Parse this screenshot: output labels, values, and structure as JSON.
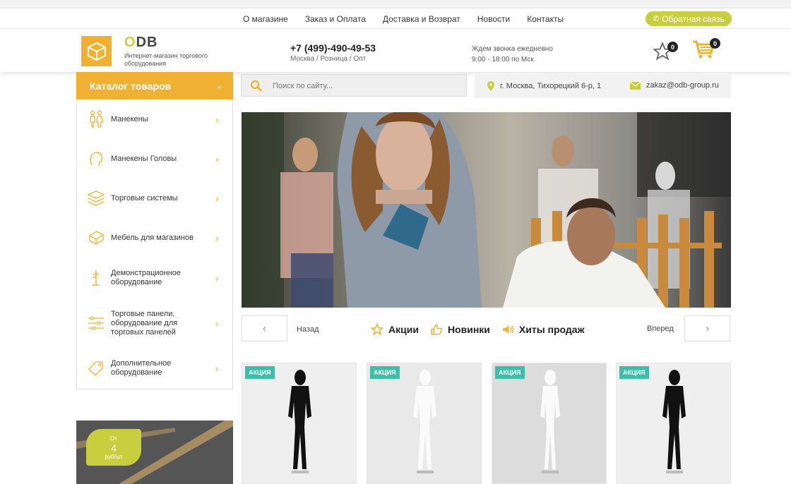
{
  "topnav": {
    "links": [
      "О магазине",
      "Заказ и Оплата",
      "Доставка и Возврат",
      "Новости",
      "Контакты"
    ],
    "callback_label": "Обратная связь"
  },
  "header": {
    "logo_letter": "O",
    "logo_rest": "DB",
    "logo_subtitle": "Интернет-магазин торгового оборудования",
    "phone": "+7 (499)-490-49-53",
    "phone_sub": "Москва / Розница / Опт",
    "wait_line1": "Ждем звонка ежедневно",
    "wait_line2": "9:00 - 18:00 по Мск",
    "favorites_count": "0",
    "cart_count": "0"
  },
  "catalog": {
    "title": "Каталог товаров",
    "items": [
      {
        "label": "Манекены",
        "icon": "mannequins-icon"
      },
      {
        "label": "Манекены Головы",
        "icon": "head-icon"
      },
      {
        "label": "Торговые системы",
        "icon": "layers-icon"
      },
      {
        "label": "Мебель для магазинов",
        "icon": "furniture-icon"
      },
      {
        "label": "Демонстрационное оборудование",
        "icon": "hanger-stand-icon"
      },
      {
        "label": "Торговые панели, оборудование для торговых панелей",
        "icon": "sliders-icon"
      },
      {
        "label": "Дополнительное оборудование",
        "icon": "tag-icon"
      }
    ]
  },
  "search": {
    "placeholder": "Поиск по сайту..."
  },
  "info": {
    "address": "г. Москва, Тихорецкий 6-р, 1",
    "email": "zakaz@odb-group.ru"
  },
  "slider": {
    "prev_label": "Назад",
    "next_label": "Вперед"
  },
  "tabs": [
    {
      "label": "Акции",
      "icon": "star-icon"
    },
    {
      "label": "Новинки",
      "icon": "thumbs-up-icon"
    },
    {
      "label": "Хиты продаж",
      "icon": "megaphone-icon"
    }
  ],
  "promo": {
    "line1": "От",
    "value": "4",
    "line3": "руб/шт"
  },
  "products": [
    {
      "tag": "АКЦИЯ",
      "color": "black"
    },
    {
      "tag": "АКЦИЯ",
      "color": "white"
    },
    {
      "tag": "АКЦИЯ",
      "color": "white"
    },
    {
      "tag": "АКЦИЯ",
      "color": "black"
    }
  ],
  "colors": {
    "accent": "#f0b032",
    "lime": "#c8cf3e",
    "teal": "#3bbfa8"
  }
}
